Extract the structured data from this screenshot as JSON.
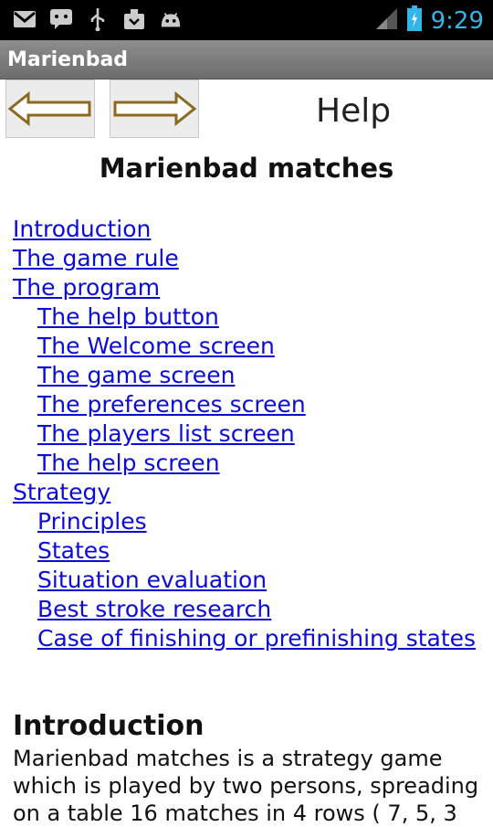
{
  "status_bar": {
    "time": "9:29",
    "icons": [
      "gmail-icon",
      "chat-icon",
      "usb-icon",
      "download-icon",
      "android-icon"
    ]
  },
  "app": {
    "title": "Marienbad"
  },
  "toolbar": {
    "page_label": "Help"
  },
  "page": {
    "heading": "Marienbad matches",
    "toc": [
      {
        "label": "Introduction",
        "level": 1
      },
      {
        "label": "The game rule",
        "level": 1
      },
      {
        "label": "The program",
        "level": 1
      },
      {
        "label": "The help button",
        "level": 2
      },
      {
        "label": " The Welcome screen",
        "level": 2
      },
      {
        "label": "The game screen",
        "level": 2
      },
      {
        "label": "The preferences screen",
        "level": 2
      },
      {
        "label": "The players list screen",
        "level": 2
      },
      {
        "label": "The help screen",
        "level": 2
      },
      {
        "label": "Strategy",
        "level": 1
      },
      {
        "label": "Principles",
        "level": 2
      },
      {
        "label": "States",
        "level": 2
      },
      {
        "label": "Situation evaluation",
        "level": 2
      },
      {
        "label": "Best stroke research",
        "level": 2
      },
      {
        "label": "Case of finishing or prefinishing states",
        "level": 2
      }
    ],
    "section": {
      "heading": "Introduction",
      "text": "Marienbad matches is a strategy game which is played by two persons, spreading on a table 16 matches in 4 rows ( 7, 5, 3"
    }
  },
  "colors": {
    "link": "#0b0bd8",
    "clock": "#33b5e5",
    "arrow": "#8a6a1f"
  }
}
